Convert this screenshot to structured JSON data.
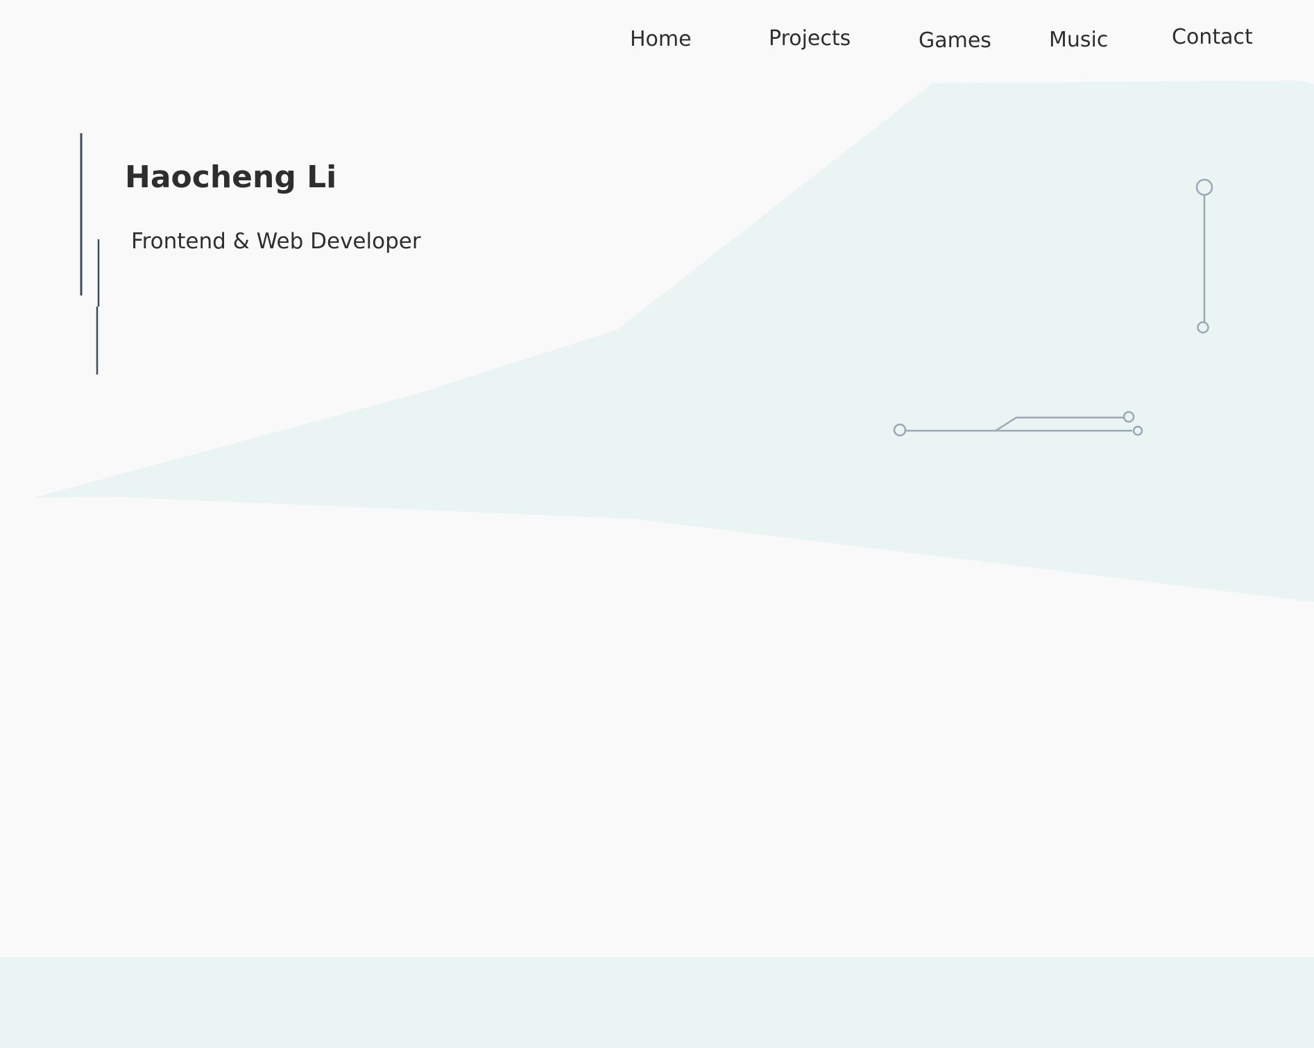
{
  "colors": {
    "background": "#f9f9f9",
    "accent_shape": "#eaf4f2",
    "text": "#2e2e2e",
    "decor_line_dark": "#3f4a5a",
    "circuit_line": "#9aa8b6"
  },
  "nav": {
    "items": [
      {
        "label": "Home"
      },
      {
        "label": "Projects"
      },
      {
        "label": "Games"
      },
      {
        "label": "Music"
      },
      {
        "label": "Contact"
      }
    ]
  },
  "hero": {
    "name": "Haocheng Li",
    "subtitle": "Frontend & Web Developer"
  }
}
